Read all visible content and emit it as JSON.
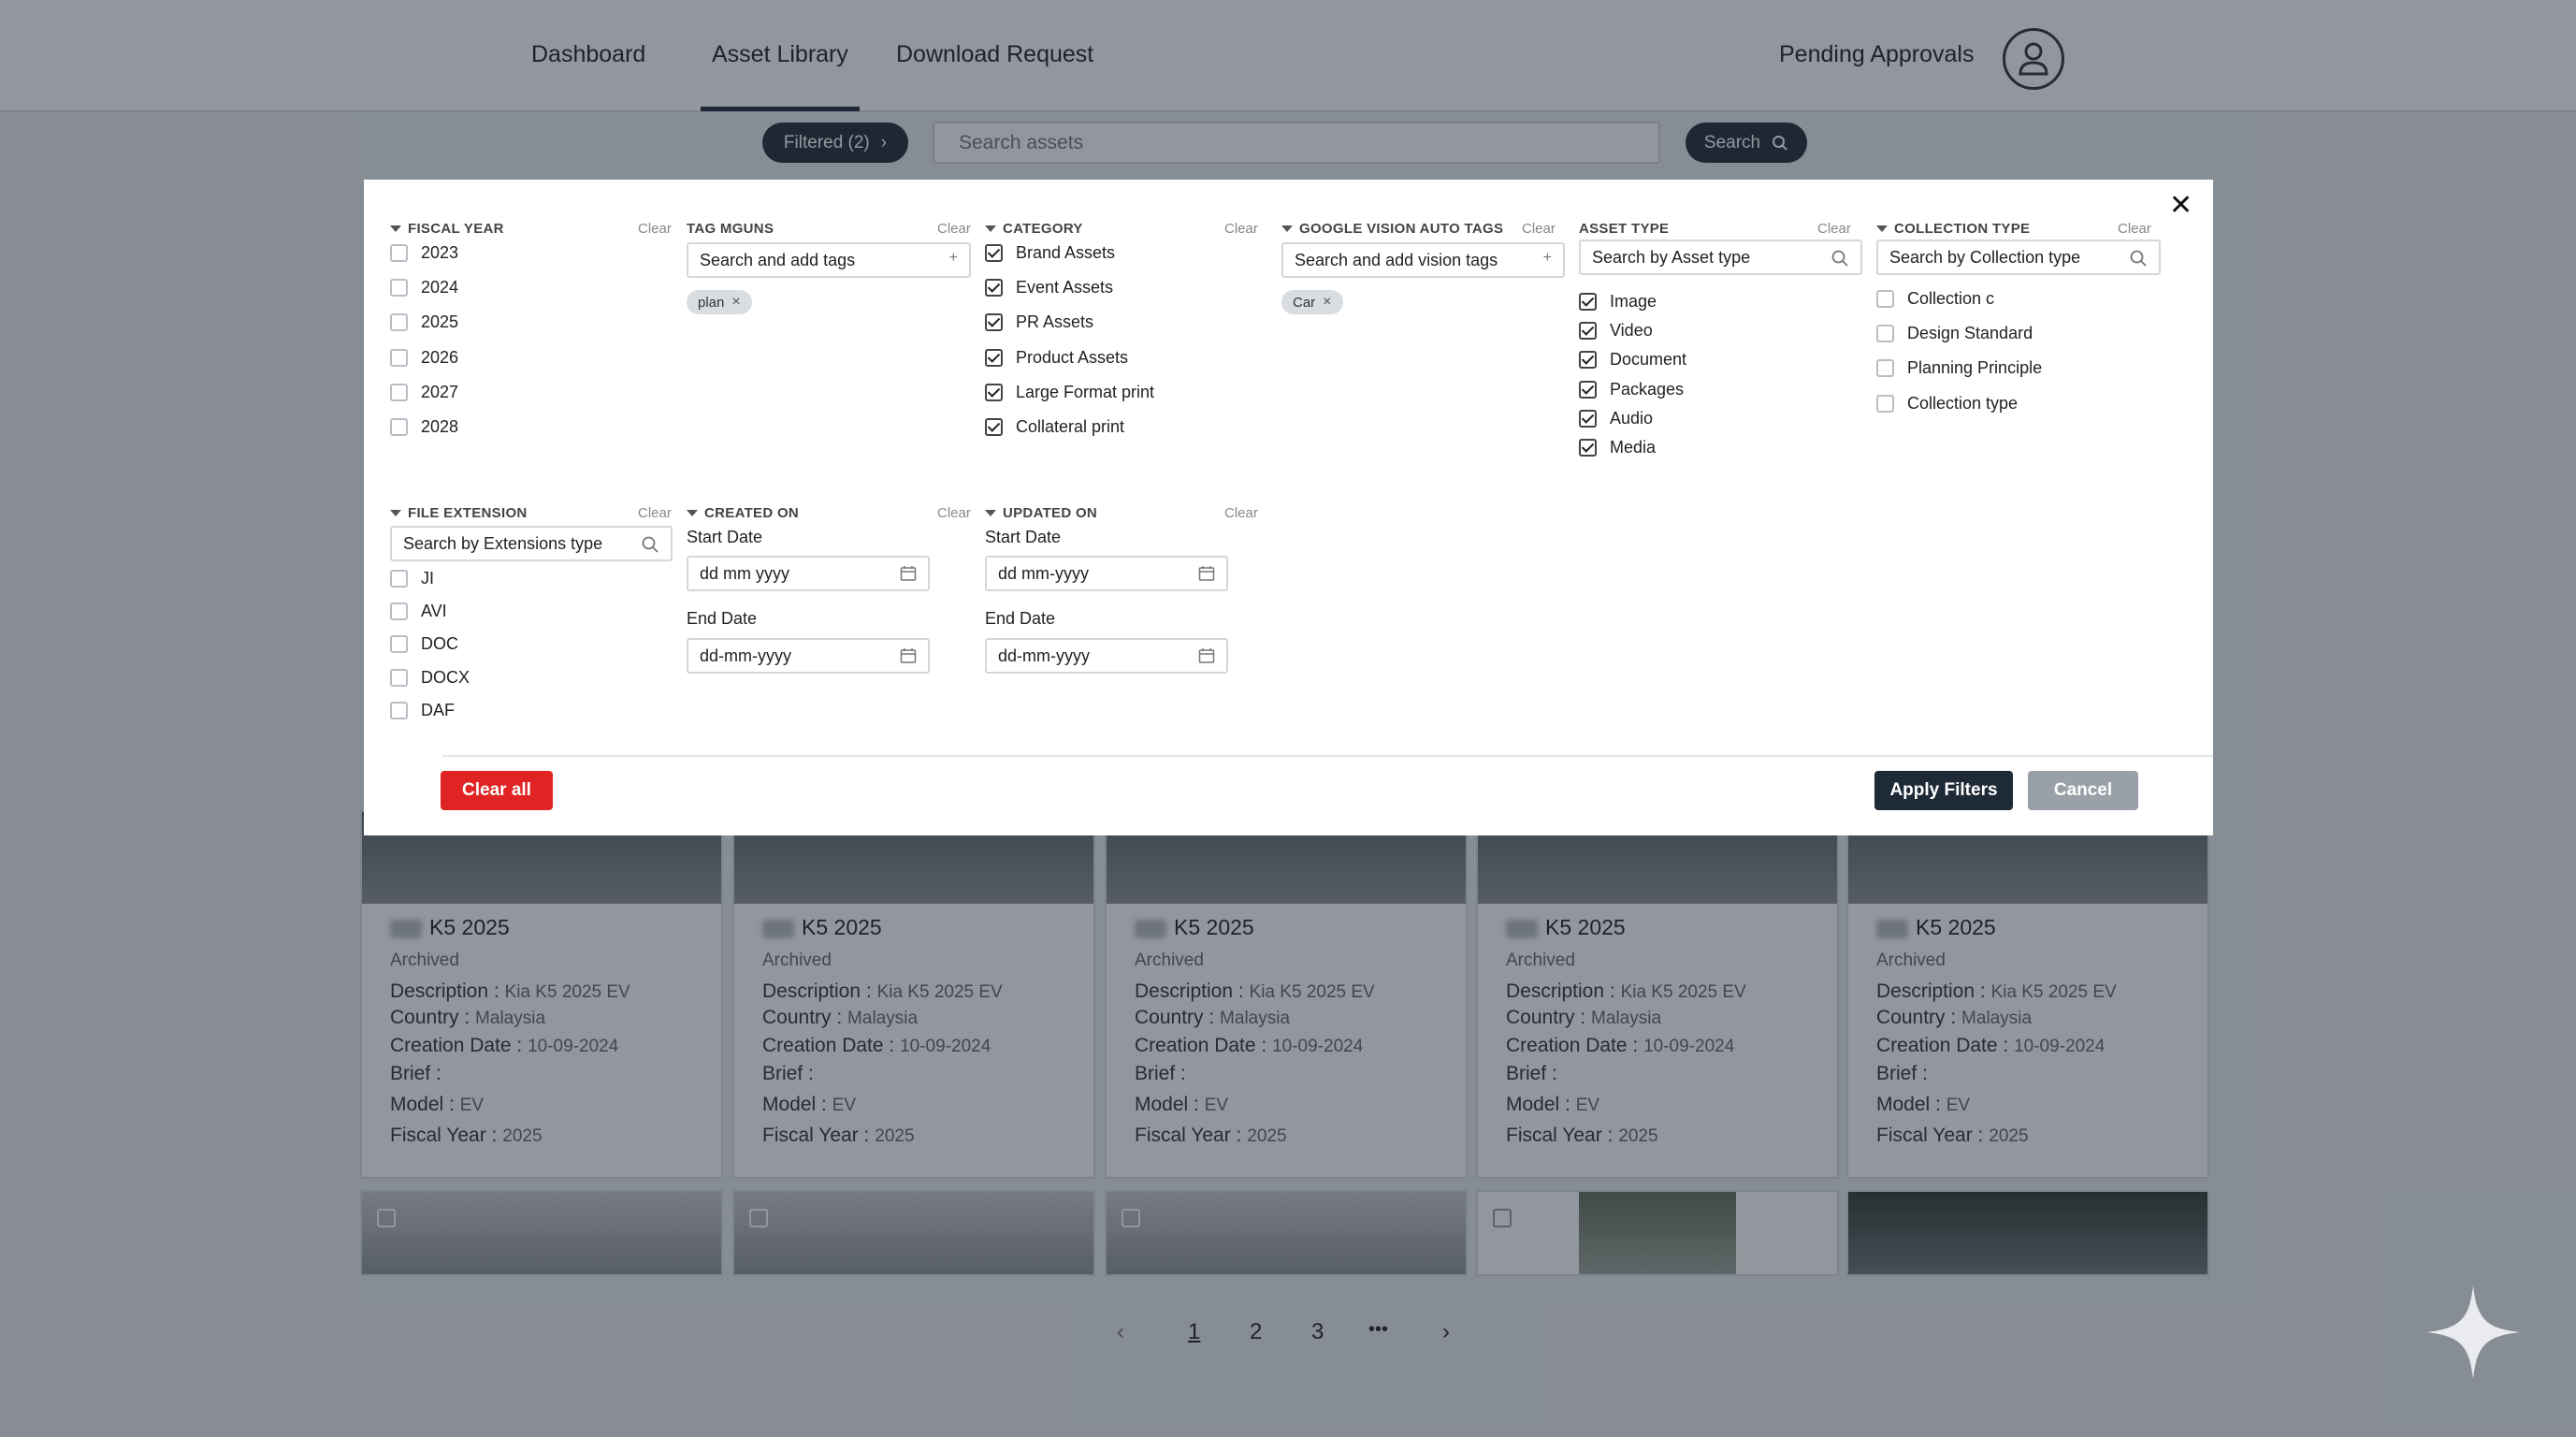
{
  "nav": {
    "tabs": [
      "Dashboard",
      "Asset Library",
      "Download Request"
    ],
    "right": "Pending Approvals"
  },
  "search": {
    "filter_pill": "Filtered (2)",
    "placeholder": "Search assets",
    "button": "Search"
  },
  "cards": {
    "title": "K5 2025",
    "status": "Archived",
    "description_label": "Description :",
    "description_value": "Kia K5 2025 EV",
    "country_label": "Country :",
    "country_value": "Malaysia",
    "date_label": "Creation Date :",
    "date_value": "10-09-2024",
    "brief_label": "Brief :",
    "model_label": "Model :",
    "model_value": "EV",
    "fy_label": "Fiscal Year :",
    "fy_value": "2025"
  },
  "pagination": [
    "1",
    "2",
    "3",
    "•••"
  ],
  "filters": {
    "clear": "Clear",
    "fiscal_year": {
      "title": "FISCAL YEAR",
      "items": [
        {
          "label": "2023",
          "checked": false
        },
        {
          "label": "2024",
          "checked": false
        },
        {
          "label": "2025",
          "checked": false
        },
        {
          "label": "2026",
          "checked": false
        },
        {
          "label": "2027",
          "checked": false
        },
        {
          "label": "2028",
          "checked": false
        }
      ]
    },
    "tag_mguns": {
      "title": "TAG MGUNS",
      "placeholder": "Search and add tags",
      "chips": [
        "plan"
      ]
    },
    "category": {
      "title": "CATEGORY",
      "items": [
        {
          "label": "Brand Assets",
          "checked": true
        },
        {
          "label": "Event Assets",
          "checked": true
        },
        {
          "label": "PR Assets",
          "checked": true
        },
        {
          "label": "Product Assets",
          "checked": true
        },
        {
          "label": "Large Format print",
          "checked": true
        },
        {
          "label": "Collateral print",
          "checked": true
        }
      ]
    },
    "vision_tags": {
      "title": "GOOGLE VISION AUTO TAGS",
      "placeholder": "Search and add vision tags",
      "chips": [
        "Car"
      ]
    },
    "asset_type": {
      "title": "ASSET TYPE",
      "placeholder": "Search by Asset type",
      "items": [
        {
          "label": "Image",
          "checked": true
        },
        {
          "label": "Video",
          "checked": true
        },
        {
          "label": "Document",
          "checked": true
        },
        {
          "label": "Packages",
          "checked": true
        },
        {
          "label": "Audio",
          "checked": true
        },
        {
          "label": "Media",
          "checked": true
        }
      ]
    },
    "collection_type": {
      "title": "COLLECTION TYPE",
      "placeholder": "Search by Collection type",
      "items": [
        {
          "label": "Collection c",
          "checked": false
        },
        {
          "label": "Design Standard",
          "checked": false
        },
        {
          "label": "Planning Principle",
          "checked": false
        },
        {
          "label": "Collection type",
          "checked": false
        }
      ]
    },
    "file_extension": {
      "title": "FILE EXTENSION",
      "placeholder": "Search by Extensions type",
      "items": [
        {
          "label": "JI",
          "checked": false
        },
        {
          "label": "AVI",
          "checked": false
        },
        {
          "label": "DOC",
          "checked": false
        },
        {
          "label": "DOCX",
          "checked": false
        },
        {
          "label": "DAF",
          "checked": false
        }
      ]
    },
    "created_on": {
      "title": "CREATED ON",
      "start_label": "Start Date",
      "start_value": "dd mm yyyy",
      "end_label": "End Date",
      "end_value": "dd-mm-yyyy"
    },
    "updated_on": {
      "title": "UPDATED ON",
      "start_label": "Start Date",
      "start_value": "dd mm-yyyy",
      "end_label": "End Date",
      "end_value": "dd-mm-yyyy"
    },
    "buttons": {
      "clear_all": "Clear all",
      "apply": "Apply Filters",
      "cancel": "Cancel"
    }
  },
  "colors": {
    "primary": "#1f2a37",
    "danger": "#e02424",
    "muted": "#9aa0a7"
  }
}
